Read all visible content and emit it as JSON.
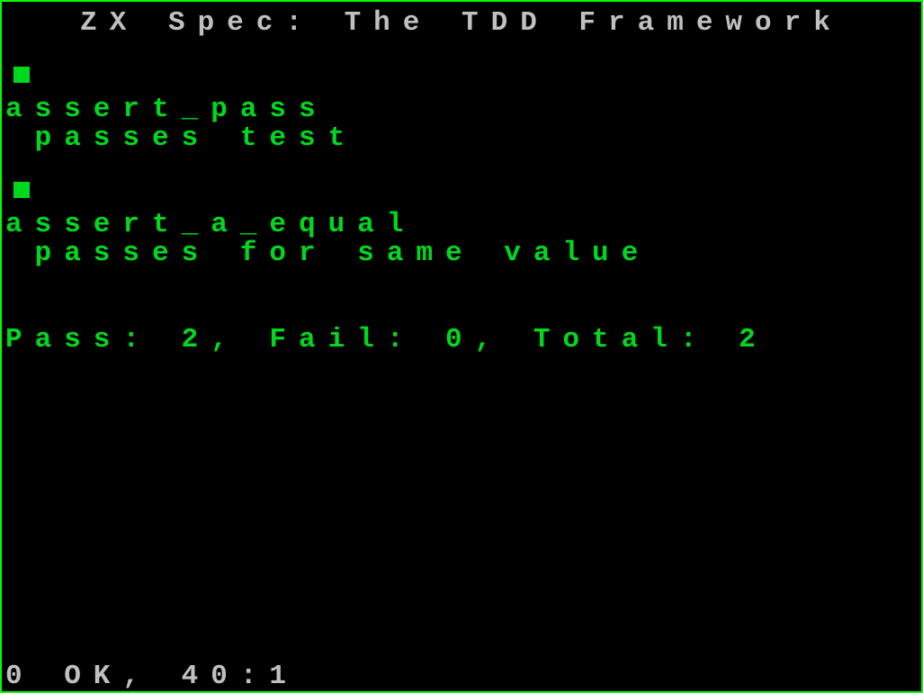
{
  "title": "ZX Spec: The TDD Framework",
  "tests": [
    {
      "name": "assert_pass",
      "desc": " passes test"
    },
    {
      "name": "assert_a_equal",
      "desc": " passes for same value"
    }
  ],
  "summary": "Pass: 2, Fail: 0, Total: 2",
  "status": "0 OK, 40:1"
}
